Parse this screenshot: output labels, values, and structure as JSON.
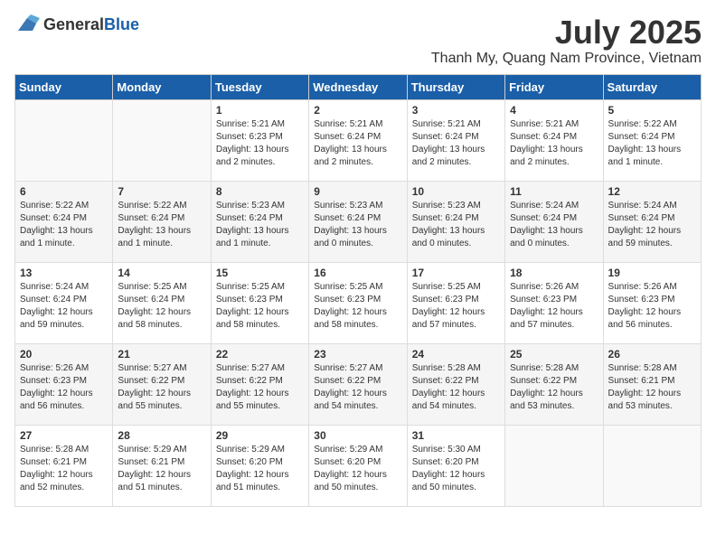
{
  "logo": {
    "general": "General",
    "blue": "Blue"
  },
  "header": {
    "title": "July 2025",
    "subtitle": "Thanh My, Quang Nam Province, Vietnam"
  },
  "days_of_week": [
    "Sunday",
    "Monday",
    "Tuesday",
    "Wednesday",
    "Thursday",
    "Friday",
    "Saturday"
  ],
  "weeks": [
    [
      {
        "day": "",
        "info": ""
      },
      {
        "day": "",
        "info": ""
      },
      {
        "day": "1",
        "info": "Sunrise: 5:21 AM\nSunset: 6:23 PM\nDaylight: 13 hours\nand 2 minutes."
      },
      {
        "day": "2",
        "info": "Sunrise: 5:21 AM\nSunset: 6:24 PM\nDaylight: 13 hours\nand 2 minutes."
      },
      {
        "day": "3",
        "info": "Sunrise: 5:21 AM\nSunset: 6:24 PM\nDaylight: 13 hours\nand 2 minutes."
      },
      {
        "day": "4",
        "info": "Sunrise: 5:21 AM\nSunset: 6:24 PM\nDaylight: 13 hours\nand 2 minutes."
      },
      {
        "day": "5",
        "info": "Sunrise: 5:22 AM\nSunset: 6:24 PM\nDaylight: 13 hours\nand 1 minute."
      }
    ],
    [
      {
        "day": "6",
        "info": "Sunrise: 5:22 AM\nSunset: 6:24 PM\nDaylight: 13 hours\nand 1 minute."
      },
      {
        "day": "7",
        "info": "Sunrise: 5:22 AM\nSunset: 6:24 PM\nDaylight: 13 hours\nand 1 minute."
      },
      {
        "day": "8",
        "info": "Sunrise: 5:23 AM\nSunset: 6:24 PM\nDaylight: 13 hours\nand 1 minute."
      },
      {
        "day": "9",
        "info": "Sunrise: 5:23 AM\nSunset: 6:24 PM\nDaylight: 13 hours\nand 0 minutes."
      },
      {
        "day": "10",
        "info": "Sunrise: 5:23 AM\nSunset: 6:24 PM\nDaylight: 13 hours\nand 0 minutes."
      },
      {
        "day": "11",
        "info": "Sunrise: 5:24 AM\nSunset: 6:24 PM\nDaylight: 13 hours\nand 0 minutes."
      },
      {
        "day": "12",
        "info": "Sunrise: 5:24 AM\nSunset: 6:24 PM\nDaylight: 12 hours\nand 59 minutes."
      }
    ],
    [
      {
        "day": "13",
        "info": "Sunrise: 5:24 AM\nSunset: 6:24 PM\nDaylight: 12 hours\nand 59 minutes."
      },
      {
        "day": "14",
        "info": "Sunrise: 5:25 AM\nSunset: 6:24 PM\nDaylight: 12 hours\nand 58 minutes."
      },
      {
        "day": "15",
        "info": "Sunrise: 5:25 AM\nSunset: 6:23 PM\nDaylight: 12 hours\nand 58 minutes."
      },
      {
        "day": "16",
        "info": "Sunrise: 5:25 AM\nSunset: 6:23 PM\nDaylight: 12 hours\nand 58 minutes."
      },
      {
        "day": "17",
        "info": "Sunrise: 5:25 AM\nSunset: 6:23 PM\nDaylight: 12 hours\nand 57 minutes."
      },
      {
        "day": "18",
        "info": "Sunrise: 5:26 AM\nSunset: 6:23 PM\nDaylight: 12 hours\nand 57 minutes."
      },
      {
        "day": "19",
        "info": "Sunrise: 5:26 AM\nSunset: 6:23 PM\nDaylight: 12 hours\nand 56 minutes."
      }
    ],
    [
      {
        "day": "20",
        "info": "Sunrise: 5:26 AM\nSunset: 6:23 PM\nDaylight: 12 hours\nand 56 minutes."
      },
      {
        "day": "21",
        "info": "Sunrise: 5:27 AM\nSunset: 6:22 PM\nDaylight: 12 hours\nand 55 minutes."
      },
      {
        "day": "22",
        "info": "Sunrise: 5:27 AM\nSunset: 6:22 PM\nDaylight: 12 hours\nand 55 minutes."
      },
      {
        "day": "23",
        "info": "Sunrise: 5:27 AM\nSunset: 6:22 PM\nDaylight: 12 hours\nand 54 minutes."
      },
      {
        "day": "24",
        "info": "Sunrise: 5:28 AM\nSunset: 6:22 PM\nDaylight: 12 hours\nand 54 minutes."
      },
      {
        "day": "25",
        "info": "Sunrise: 5:28 AM\nSunset: 6:22 PM\nDaylight: 12 hours\nand 53 minutes."
      },
      {
        "day": "26",
        "info": "Sunrise: 5:28 AM\nSunset: 6:21 PM\nDaylight: 12 hours\nand 53 minutes."
      }
    ],
    [
      {
        "day": "27",
        "info": "Sunrise: 5:28 AM\nSunset: 6:21 PM\nDaylight: 12 hours\nand 52 minutes."
      },
      {
        "day": "28",
        "info": "Sunrise: 5:29 AM\nSunset: 6:21 PM\nDaylight: 12 hours\nand 51 minutes."
      },
      {
        "day": "29",
        "info": "Sunrise: 5:29 AM\nSunset: 6:20 PM\nDaylight: 12 hours\nand 51 minutes."
      },
      {
        "day": "30",
        "info": "Sunrise: 5:29 AM\nSunset: 6:20 PM\nDaylight: 12 hours\nand 50 minutes."
      },
      {
        "day": "31",
        "info": "Sunrise: 5:30 AM\nSunset: 6:20 PM\nDaylight: 12 hours\nand 50 minutes."
      },
      {
        "day": "",
        "info": ""
      },
      {
        "day": "",
        "info": ""
      }
    ]
  ]
}
